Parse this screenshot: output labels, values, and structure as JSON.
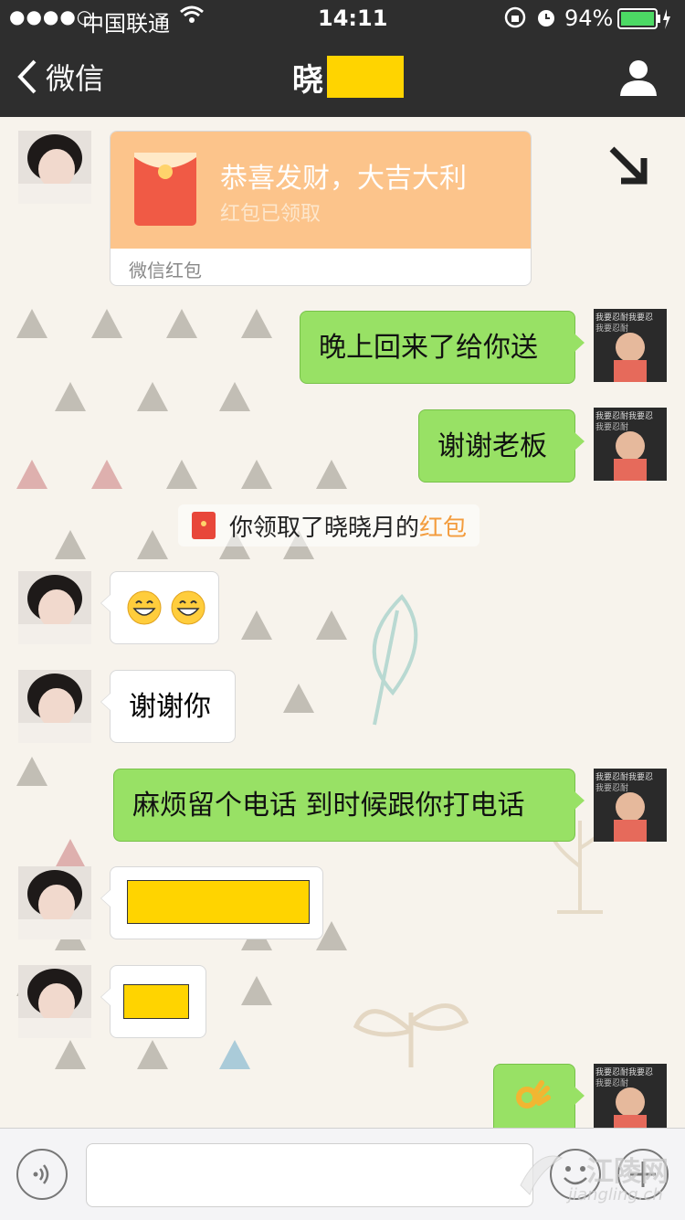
{
  "status_bar": {
    "signal_dots": "●●●●○",
    "carrier": "中国联通",
    "time": "14:11",
    "battery_percent": "94%"
  },
  "nav": {
    "back_label": "微信",
    "title": "晓"
  },
  "red_packet": {
    "title": "恭喜发财，大吉大利",
    "status": "红包已领取",
    "footer": "微信红包"
  },
  "messages": {
    "m1": "晚上回来了给你送",
    "m2": "谢谢老板",
    "m3": "谢谢你",
    "m4": "麻烦留个电话 到时候跟你打电话"
  },
  "system_notice": {
    "text": "你领取了晓晓月的",
    "link": "红包"
  },
  "kid_avatar_text": "我要忍耐",
  "watermark": {
    "name": "江陵网",
    "url": "jiangling.ch"
  },
  "colors": {
    "navbar": "#2e2e2e",
    "green_bubble": "#98e165",
    "red_packet_orange": "#fcc48b",
    "link_orange": "#f39c3d",
    "mask_yellow": "#ffd400"
  }
}
